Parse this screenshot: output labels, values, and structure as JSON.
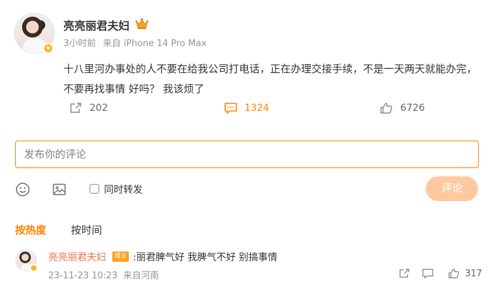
{
  "post": {
    "author": "亮亮丽君夫妇",
    "time": "3小时前",
    "source": "来自 iPhone 14 Pro Max",
    "text": "十八里河办事处的人不要在给我公司打电话，正在办理交接手续，不是一天两天就能办完， 不要再找事情 好吗？   我该烦了",
    "reposts": "202",
    "comments": "1324",
    "likes": "6726"
  },
  "composer": {
    "placeholder": "发布你的评论",
    "repost_label": "同时转发",
    "submit_label": "评论"
  },
  "sort": {
    "hot": "按热度",
    "time": "按时间"
  },
  "comments": [
    {
      "author": "亮亮丽君夫妇",
      "tag": "博主",
      "text": ":丽君脾气好   我脾气不好   别搞事情",
      "time": "23-11-23 10:23",
      "location": "来自河南",
      "likes": "317"
    }
  ],
  "colors": {
    "accent": "#ff8200",
    "verified": "#f7b92b",
    "submit_disabled": "#ffc9a0"
  },
  "icons": [
    "crown-icon",
    "verified-icon",
    "repost-icon",
    "comment-icon",
    "like-icon",
    "emoji-icon",
    "image-icon",
    "reply-icon"
  ]
}
